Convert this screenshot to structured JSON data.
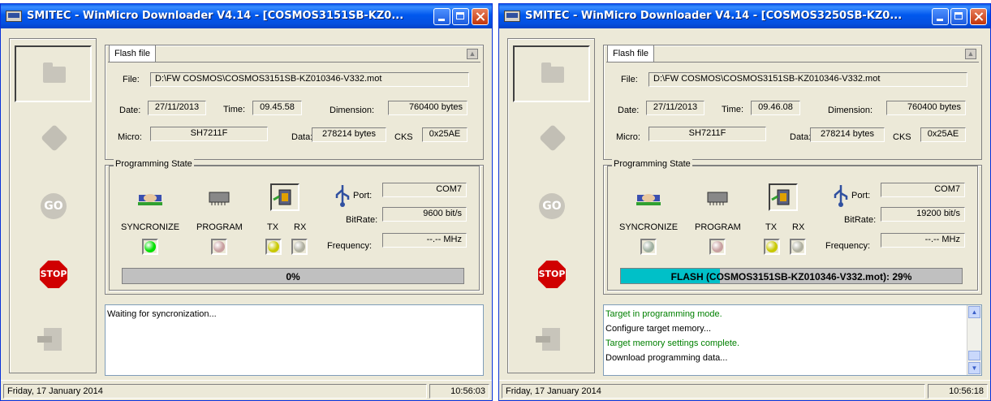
{
  "windows": [
    {
      "title": "SMITEC - WinMicro Downloader V4.14 - [COSMOS3151SB-KZ0...",
      "flash": {
        "tab_label": "Flash file",
        "file_label": "File:",
        "file_value": "D:\\FW COSMOS\\COSMOS3151SB-KZ010346-V332.mot",
        "date_label": "Date:",
        "date_value": "27/11/2013",
        "time_label": "Time:",
        "time_value": "09.45.58",
        "dimension_label": "Dimension:",
        "dimension_value": "760400 bytes",
        "micro_label": "Micro:",
        "micro_value": "SH7211F",
        "data_label": "Data:",
        "data_value": "278214 bytes",
        "cks_label": "CKS",
        "cks_value": "0x25AE"
      },
      "programming": {
        "group_title": "Programming State",
        "port_label": "Port:",
        "port_value": "COM7",
        "bitrate_label": "BitRate:",
        "bitrate_value": "9600 bit/s",
        "frequency_label": "Frequency:",
        "frequency_value": "--.-- MHz",
        "sync_label": "SYNCRONIZE",
        "program_label": "PROGRAM",
        "tx_label": "TX",
        "rx_label": "RX",
        "progress_text": "0%",
        "progress_fraction": 0.0,
        "led_colors": {
          "sync": "#00e000",
          "program": "#c8a0a0",
          "tx": "#c8c800",
          "rx": "#b0b0a0"
        }
      },
      "side_buttons": {
        "go_label": "GO",
        "stop_label": "STOP"
      },
      "log": [
        {
          "text": "Waiting for syncronization...",
          "color": "#000000"
        }
      ],
      "status": {
        "date": "Friday, 17 January 2014",
        "time": "10:56:03"
      }
    },
    {
      "title": "SMITEC - WinMicro Downloader V4.14 - [COSMOS3250SB-KZ0...",
      "flash": {
        "tab_label": "Flash file",
        "file_label": "File:",
        "file_value": "D:\\FW COSMOS\\COSMOS3151SB-KZ010346-V332.mot",
        "date_label": "Date:",
        "date_value": "27/11/2013",
        "time_label": "Time:",
        "time_value": "09.46.08",
        "dimension_label": "Dimension:",
        "dimension_value": "760400 bytes",
        "micro_label": "Micro:",
        "micro_value": "SH7211F",
        "data_label": "Data:",
        "data_value": "278214 bytes",
        "cks_label": "CKS",
        "cks_value": "0x25AE"
      },
      "programming": {
        "group_title": "Programming State",
        "port_label": "Port:",
        "port_value": "COM7",
        "bitrate_label": "BitRate:",
        "bitrate_value": "19200 bit/s",
        "frequency_label": "Frequency:",
        "frequency_value": "--.-- MHz",
        "sync_label": "SYNCRONIZE",
        "program_label": "PROGRAM",
        "tx_label": "TX",
        "rx_label": "RX",
        "progress_text": "FLASH (COSMOS3151SB-KZ010346-V332.mot): 29%",
        "progress_fraction": 0.29,
        "led_colors": {
          "sync": "#a0b0a0",
          "program": "#c8a0a0",
          "tx": "#c8c800",
          "rx": "#b0b0a0"
        }
      },
      "side_buttons": {
        "go_label": "GO",
        "stop_label": "STOP"
      },
      "log": [
        {
          "text": "Target in programming mode.",
          "color": "#008000"
        },
        {
          "text": "Configure target memory...",
          "color": "#000000"
        },
        {
          "text": "Target memory settings complete.",
          "color": "#008000"
        },
        {
          "text": "Download programming data...",
          "color": "#000000"
        }
      ],
      "status": {
        "date": "Friday, 17 January 2014",
        "time": "10:56:18"
      }
    }
  ]
}
